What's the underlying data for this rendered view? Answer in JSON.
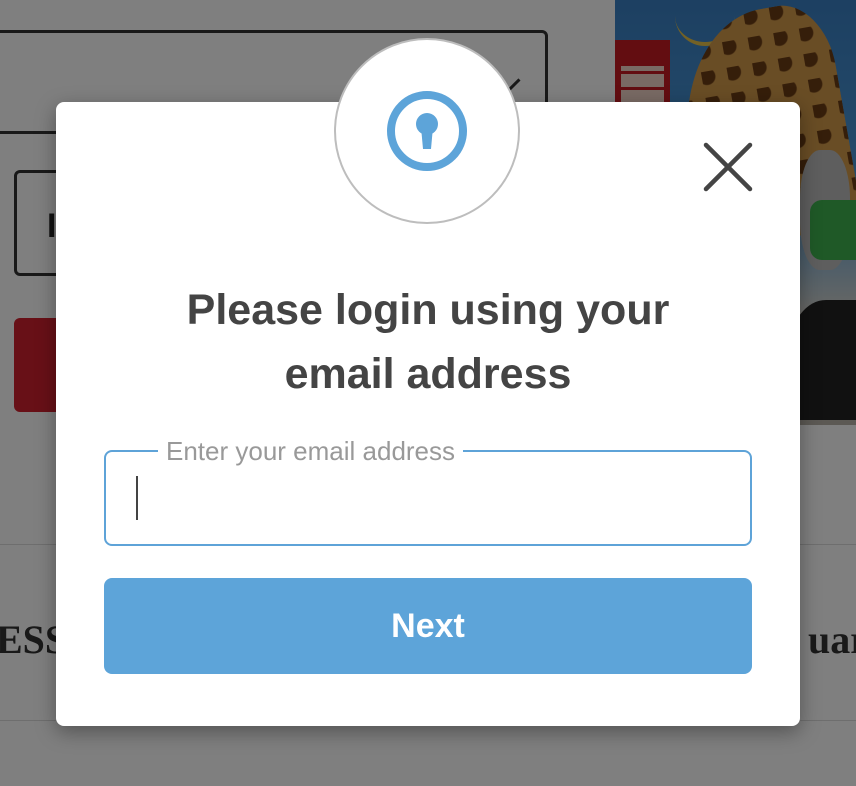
{
  "background": {
    "select_text": "",
    "box2_letter": "I",
    "bottom_left_word": "ESS",
    "bottom_right_word": "uard"
  },
  "modal": {
    "icon": "keyhole-lock-icon",
    "close_icon": "close-icon",
    "heading_line1": "Please login using your",
    "heading_line2": "email address",
    "email_label": "Enter your email address",
    "email_value": "",
    "next_label": "Next"
  },
  "colors": {
    "accent": "#5da4d9",
    "heading": "#444444",
    "overlay": "rgba(0,0,0,0.5)"
  }
}
